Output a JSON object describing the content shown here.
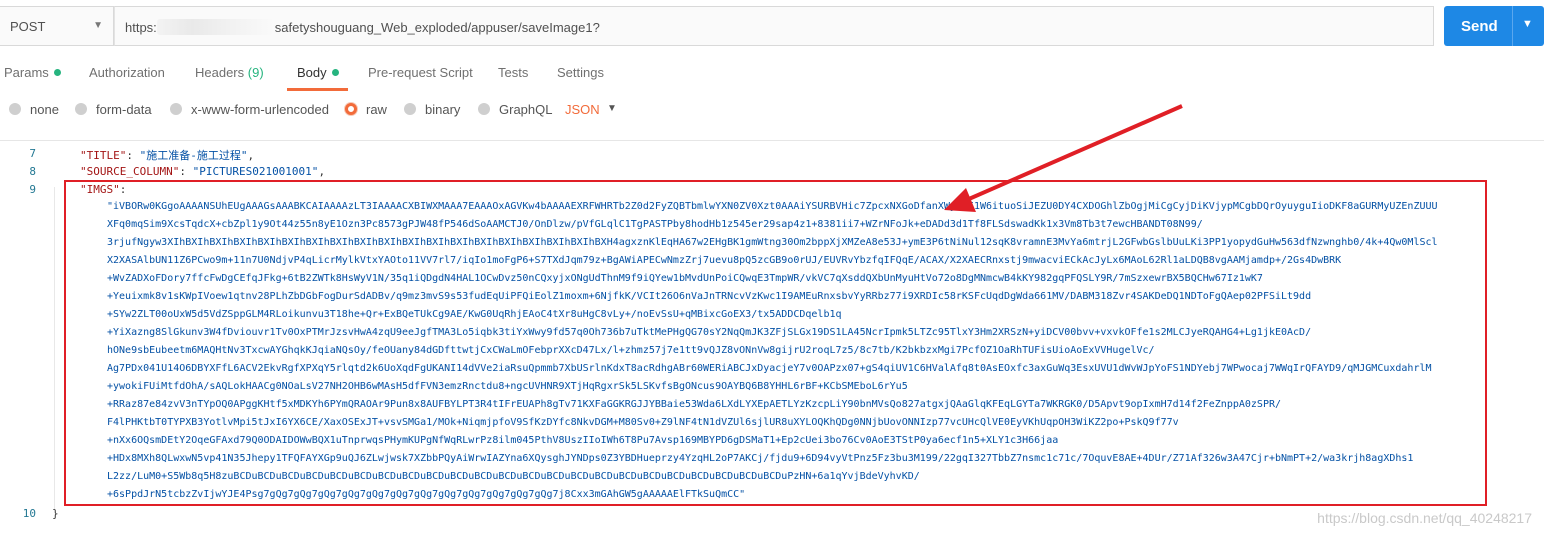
{
  "request": {
    "method": "POST",
    "url_prefix": "https:",
    "url_suffix": "safetyshouguang_Web_exploded/appuser/saveImage1?",
    "send_label": "Send"
  },
  "tabs": [
    {
      "label": "Params",
      "dot": true
    },
    {
      "label": "Authorization"
    },
    {
      "label": "Headers",
      "count": "(9)"
    },
    {
      "label": "Body",
      "dot": true,
      "active": true
    },
    {
      "label": "Pre-request Script"
    },
    {
      "label": "Tests"
    },
    {
      "label": "Settings"
    }
  ],
  "body_types": [
    "none",
    "form-data",
    "x-www-form-urlencoded",
    "raw",
    "binary",
    "GraphQL"
  ],
  "body_type_selected": "raw",
  "format": "JSON",
  "editor": {
    "line_numbers": [
      "7",
      "8",
      "9",
      "10"
    ],
    "title_key": "\"TITLE\"",
    "title_value": "\"施工准备-施工过程\"",
    "source_key": "\"SOURCE_COLUMN\"",
    "source_value": "\"PICTURES021001001\"",
    "imgs_key": "\"IMGS\"",
    "closing_brace": "}",
    "base64_lines": [
      "\"iVBORw0KGgoAAAANSUhEUgAAAGsAAABKCAIAAAAzLT3IAAAACXBIWXMAAA7EAAAOxAGVKw4bAAAAEXRFWHRTb2Z0d2FyZQBTbmlwYXN0ZV0Xzt0AAAiYSURBVHic7ZpcxNXGoDfanXWyb1I1W6ituoSiJEZU0DY4CXDOGhlZbOgjMiCgCyjDiKVjypMCgbDQrOyuyguIioDKF8aGURMyUZEnZUUU",
      "XFq0mqSim9XcsTqdcX+cbZpl1y9Ot44z55n8yE1Ozn3Pc8573gPJW48fP546dSoAAMCTJ0/OnDlzw/pVfGLqlC1TgPASTPby8hodHb1z545er29sap4z1+8381ii7+WZrNFoJk+eDADd3d1Tf8FLSdswadKk1x3Vm8Tb3t7ewcHBANDT08N99/",
      "3rjufNgyw3XIhBXIhBXIhBXIhBXIhBXIhBXIhBXIhBXIhBXIhBXIhBXIhBXIhBXIhBXIhBXIhBXIhBXIhBXH4agxznKlEqHA67w2EHgBK1gmWtng30Om2bppXjXMZeA8e53J+ymE3P6tNiNul12sqK8vramnE3MvYa6mtrjL2GFwbGslbUuLKi3PP1yopydGuHw563dfNzwnghb0/4k+4Qw0MlScl",
      "X2XASAlbUN11Z6PCwo9m+11n7U0NdjvP4qLicrMylkVtxYAOto11VV7rl7/iqIo1moFgP6+S7TXdJqm79z+BgAWiAPECwNmzZrj7uevu8pQ5zcGB9o0rUJ/EUVRvYbzfqIFQqE/ACAX/X2XAECRnxstj9mwacviECkAcJyLx6MAoL62Rl1aLDQB8vgAAMjamdp+/2Gs4DwBRK",
      "+WvZADXoFDory7ffcFwDgCEfqJFkg+6tB2ZWTk8HsWyV1N/35q1iQDgdN4HAL1OCwDvz50nCQxyjxONgUdThnM9f9iQYew1bMvdUnPoiCQwqE3TmpWR/vkVC7qXsddQXbUnMyuHtVo72o8DgMNmcwB4kKY982gqPFQSLY9R/7mSzxewrBX5BQCHw67Iz1wK7",
      "+Yeuixmk8v1sKWpIVoew1qtnv28PLhZbDGbFogDurSdADBv/q9mz3mvS9s53fudEqUiPFQiEolZ1moxm+6NjfkK/VCIt26O6nVaJnTRNcvVzKwc1I9AMEuRnxsbvYyRRbz77i9XRDIc58rKSFcUqdDgWda661MV/DABM318Zvr4SAKDeDQ1NDToFgQAep02PFSiLt9dd",
      "+SYw2ZLT00oUxW5d5VdZSppGLM4RLoikunvu3T18he+Qr+ExBQeTUkCg9AE/KwG0UqRhjEAoC4tXr8uHgC8vLy+/noEvSsU+qMBixcGoEX3/tx5ADDCDqelb1q",
      "+YiXazng8SlGkunv3W4fDviouvr1Tv0OxPTMrJzsvHwA4zqU9eeJgfTMA3Lo5iqbk3tiYxWwy9fd57q0Oh736b7uTktMePHgQG70sY2NqQmJK3ZFjSLGx19DS1LA45NcrIpmk5LTZc95TlxY3Hm2XRSzN+yiDCV00bvv+vxvkOFfe1s2MLCJyeRQAHG4+Lg1jkE0AcD/",
      "hONe9sbEubeetm6MAQHtNv3TxcwAYGhqkKJqiaNQsOy/feOUany84dGDfttwtjCxCWaLmOFebprXXcD47Lx/l+zhmz57j7e1tt9vQJZ8vONnVw8gijrU2roqL7z5/8c7tb/K2bkbzxMgi7PcfOZ1OaRhTUFisUioAoExVVHugelVc/",
      "Ag7PDx041U14O6DBYXFfL6ACV2EkvRgfXPXqY5rlqtd2k6UoXqdFgUKANI14dVVe2iaRsuQpmmb7XbUSrlnKdxT8acRdhgABr60WERiABCJxDyacjeY7v0OAPzx07+gS4qiUV1C6HValAfq8t0AsEOxfc3axGuWq3EsxUVU1dWvWJpYoFS1NDYebj7WPwocaj7WWqIrQFAYD9/qMJGMCuxdahrlM",
      "+ywokiFUiMtfdOhA/sAQLokHAACg0NOaLsV27NH2OHB6wMAsH5dfFVN3emzRnctdu8+ngcUVHNR9XTjHqRgxrSk5LSKvfsBgONcus9OAYBQ6B8YHHL6rBF+KCbSMEboL6rYu5",
      "+RRaz87e84zvV3nTYpOQ0APggKHtf5xMDKYh6PYmQRAOAr9Pun8x8AUFBYLPT3R4tIFrEUAPh8gTv71KXFaGGKRGJJYBBaie53Wda6LXdLYXEpAETLYzKzcpLiY90bnMVsQo827atgxjQAaGlqKFEqLGYTa7WKRGK0/D5Apvt9opIxmH7d14f2FeZnppA0zSPR/",
      "F4lPHKtbT0TYPXB3YotlvMpi5tJxI6YX6CE/XaxOSExJT+vsvSMGa1/MOk+NiqmjpfoV9SfKzDYfc8NkvDGM+M80Sv0+Z9lNF4tN1dVZUl6sjlUR8uXYLOQKhQDg0NNjbUovONNIzp77vcUHcQlVE0EyVKhUqpOH3WiKZ2po+PskQ9f77v",
      "+nXx6OQsmDEtY2OqeGFAxd79Q0ODAIDOWwBQX1uTnprwqsPHymKUPgNfWqRLwrPz8ilm045PthV8UszIIoIWh6T8Pu7Avsp169MBYPD6gDSMaT1+Ep2cUei3bo76Cv0AoE3TStP0ya6ecf1n5+XLY1c3H66jaa",
      "+HDx8MXh8QLwxwN5vp41N35Jhepy1TFQFAYXGp9uQJ6ZLwjwsk7XZbbPQyAiWrwIAZYna6XQysghJYNDps0Z3YBDHueprzy4YzqHL2oP7AKCj/fjdu9+6D94vyVtPnz5Fz3bu3M199/22gqI327TbbZ7nsmc1c71c/7OquvE8AE+4DUr/Z71Af326w3A47Cjr+bNmPT+2/wa3krjh8agXDhs1",
      "L2zz/LuM0+S5Wb8q5H8zuBCDuBCDuBCDuBCDuBCDuBCDuBCDuBCDuBCDuBCDuBCDuBCDuBCDuBCDuBCDuBCDuBCDuBCDuBCDuBCDuBCDuBCDuBCDuPzHN+6a1qYvjBdeVyhvKD/",
      "+6sPpdJrN5tcbzZvIjwYJE4Psg7gQg7gQg7gQg7gQg7gQg7gQg7gQg7gQg7gQg7gQg7gQg7gQg7j8Cxx3mGAhGW5gAAAAAElFTkSuQmCC\""
    ]
  },
  "watermark": "https://blog.csdn.net/qq_40248217",
  "colors": {
    "accent": "#f26b3a",
    "send": "#1e88e5",
    "dot": "#26b47f",
    "highlight": "#e01f26"
  }
}
